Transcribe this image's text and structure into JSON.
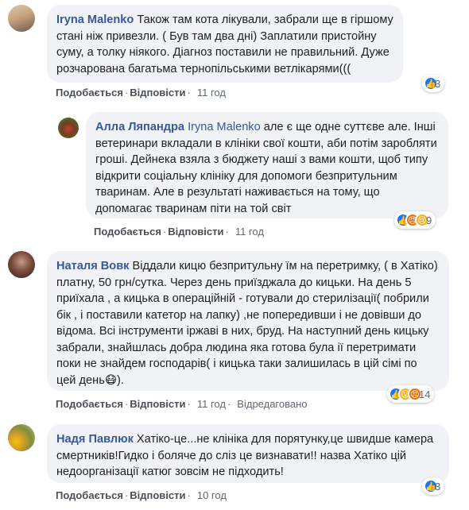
{
  "actions": {
    "like": "Подобається",
    "reply": "Відповісти",
    "edited": "Відредаговано"
  },
  "comments": [
    {
      "author": "Iryna Malenko",
      "text": "Також там кота лікували, забрали ще в гіршому стані ніж привезли. ( Був там два дні) Заплатили пристойну суму, а толку ніякого. Діагноз поставили не правильний. Дуже розчарована багатьма тернопільськими ветлікарями(((",
      "time": "11 год",
      "reaction_count": "3",
      "reactions": [
        "like-icon"
      ]
    },
    {
      "author": "Алла Ляпандра",
      "mention": "Iryna Malenko",
      "text": "але є ще одне суттєве але. Інші ветеринари вкладали в клініки свої кошти, аби потім заробляти гроші. Дейнека взяла з бюджету наші з вами кошти, щоб типу відкрити соціальну клініку для допомоги безпритульним тваринам. Але в результаті наживається на тому, що допомагає тваринам піти на той світ",
      "time": "11 год",
      "reaction_count": "9",
      "reactions": [
        "like-icon",
        "angry-icon",
        "sad-icon"
      ]
    },
    {
      "author": "Наталя Вовк",
      "text": "Віддали кицю безпритульну їм на перетримку, ( в Хатіко) платну, 50 грн/сутка. Через день приїзджала до кицьки. На день 5 приїхала , а кицька в операційній - готували до стерилізації( побрили бік , і поставили катетор на лапку) ,не попередивши і не довівши до відома. Всі інструменти іржаві в них, бруд. На наступний день кицьку забрали, знайшлась добра людина яка готова була ії перетримати поки не знайдем господарів( і кицька таки залишилась в цій сімі по цей день😷).",
      "time": "11 год",
      "reaction_count": "14",
      "reactions": [
        "like-icon",
        "wow-icon",
        "angry-icon"
      ]
    },
    {
      "author": "Надя Павлюк",
      "text": "Хатіко-це...не клініка для порятунку,це швидше камера смертників!Гидко і боляче до сліз це визнавати!! назва Хатіко цій недоорганізації катюг зовсім не підходить!",
      "time": "10 год",
      "reaction_count": "3",
      "reactions": [
        "like-icon"
      ]
    }
  ]
}
